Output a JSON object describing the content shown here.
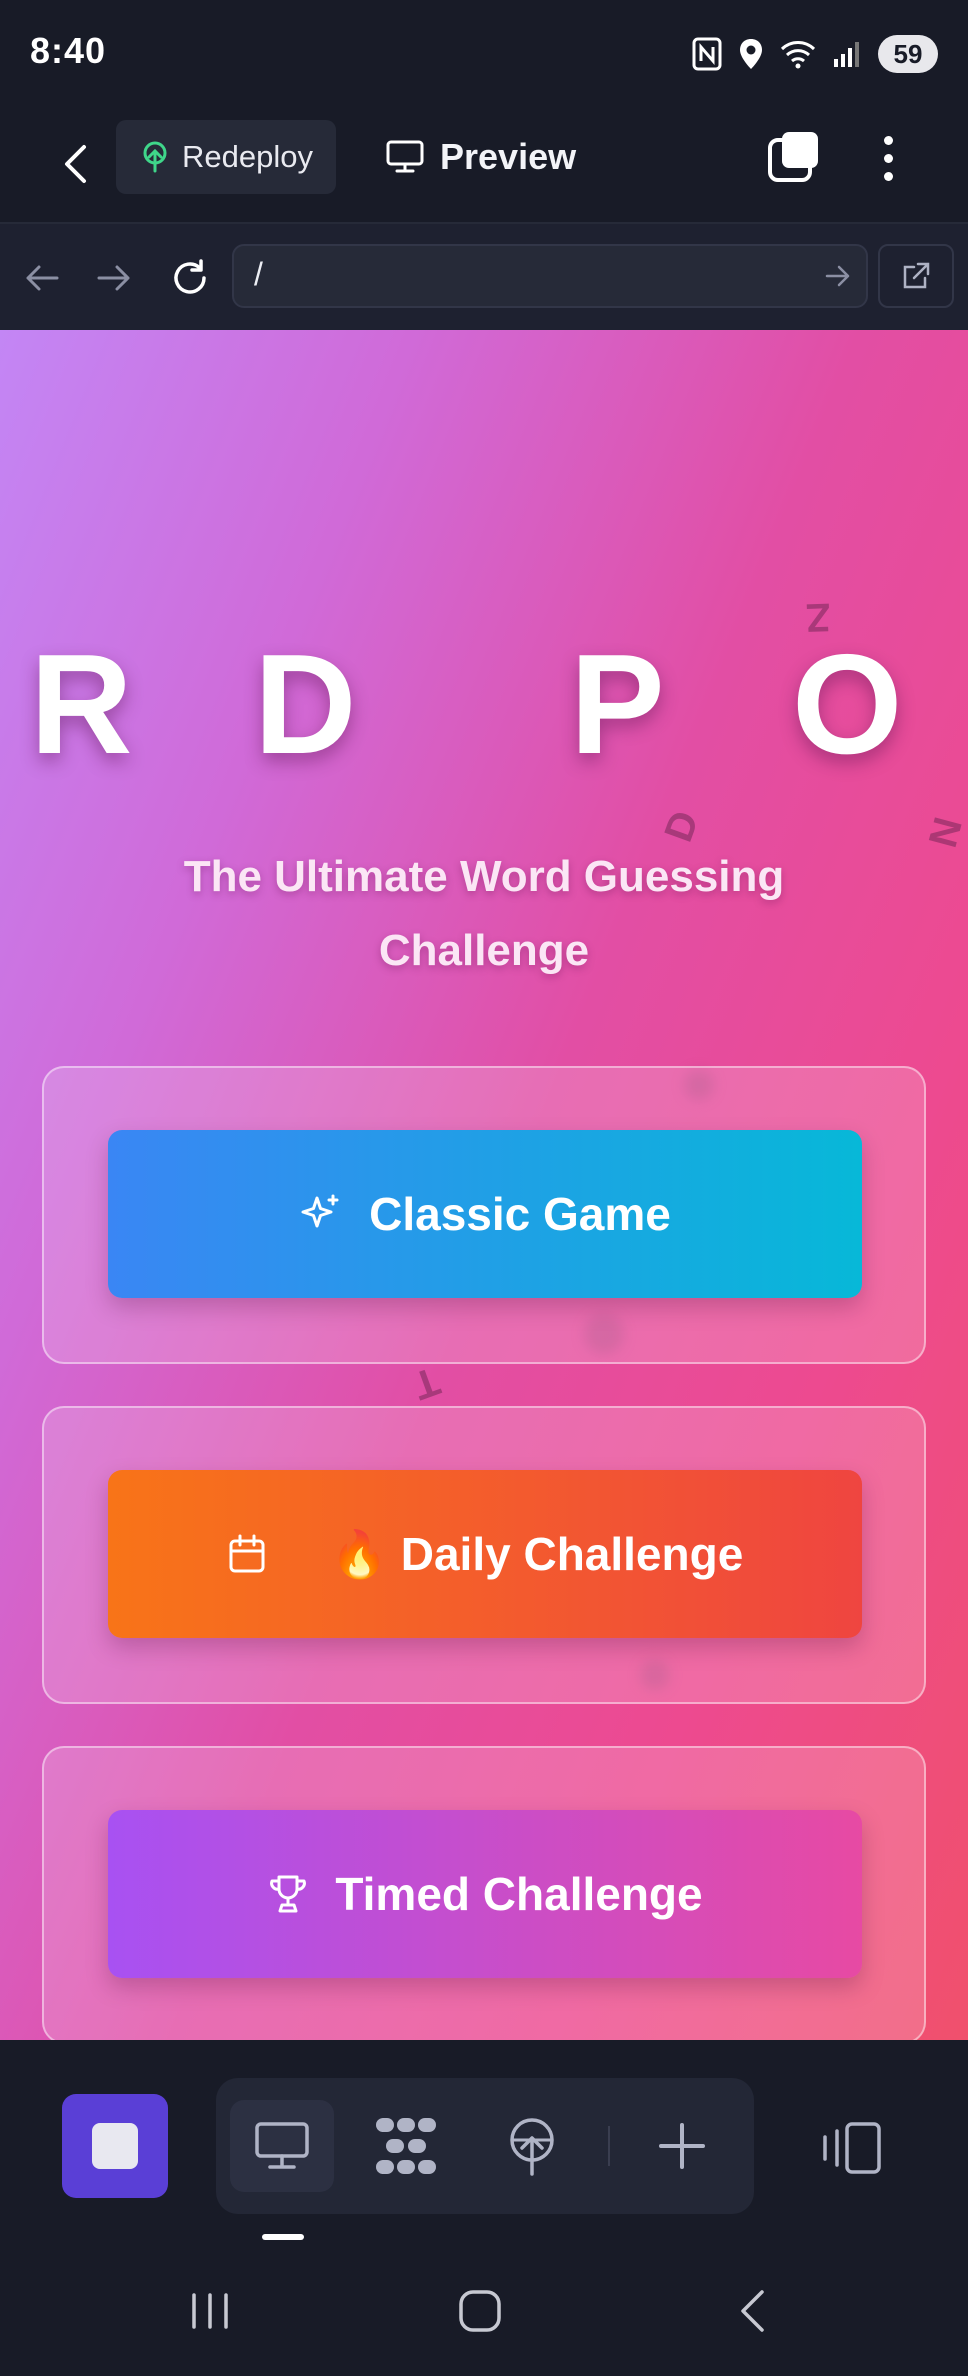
{
  "status_bar": {
    "time": "8:40",
    "battery": "59",
    "icons": [
      "nfc-icon",
      "location-icon",
      "wifi-icon",
      "signal-icon",
      "battery-icon"
    ]
  },
  "app_bar": {
    "back_icon": "chevron-left-icon",
    "redeploy_label": "Redeploy",
    "preview_label": "Preview",
    "tabs_icon": "tabs-icon",
    "menu_icon": "more-vertical-icon"
  },
  "browser_bar": {
    "url": "/",
    "icons": [
      "arrow-left-icon",
      "arrow-right-icon",
      "refresh-icon",
      "go-arrow-icon",
      "external-link-icon"
    ]
  },
  "game": {
    "title_letters": [
      "R",
      "D",
      "P",
      "O"
    ],
    "floating_letters": [
      "Z",
      "D",
      "N",
      "T"
    ],
    "subtitle": "The Ultimate Word Guessing Challenge",
    "modes": [
      {
        "label": "Classic Game",
        "icon": "sparkles-icon"
      },
      {
        "label": "🔥 Daily Challenge",
        "icon": "calendar-icon"
      },
      {
        "label": "Timed Challenge",
        "icon": "trophy-icon"
      }
    ],
    "colors": {
      "classic": [
        "#3a86f4",
        "#07b8d8"
      ],
      "daily": [
        "#f87418",
        "#ef4540"
      ],
      "timed": [
        "#a851f2",
        "#e74aa3"
      ]
    }
  },
  "bottom_toolbar": {
    "tools": [
      "stop-icon",
      "desktop-icon",
      "dots-grid-icon",
      "deploy-icon",
      "plus-icon",
      "devices-icon"
    ]
  },
  "system_nav": [
    "recents-icon",
    "home-icon",
    "back-icon"
  ]
}
